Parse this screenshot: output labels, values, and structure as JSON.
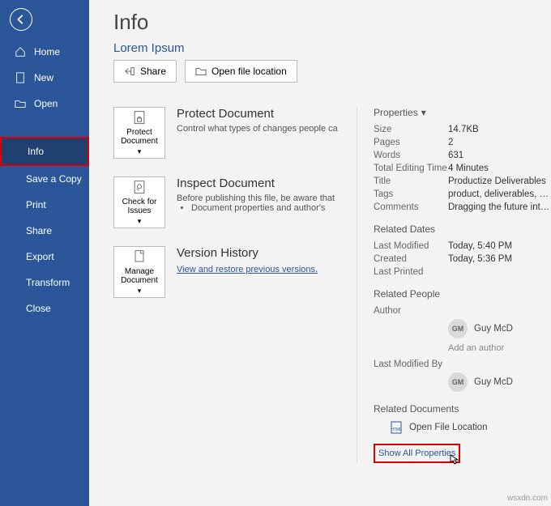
{
  "sidebar": {
    "items": [
      {
        "label": "Home"
      },
      {
        "label": "New"
      },
      {
        "label": "Open"
      },
      {
        "label": "Info",
        "selected": true
      },
      {
        "label": "Save a Copy"
      },
      {
        "label": "Print"
      },
      {
        "label": "Share"
      },
      {
        "label": "Export"
      },
      {
        "label": "Transform"
      },
      {
        "label": "Close"
      }
    ]
  },
  "page": {
    "title": "Info",
    "doc_name": "Lorem Ipsum",
    "share": "Share",
    "open_loc": "Open file location"
  },
  "protect": {
    "tile": "Protect Document",
    "head": "Protect Document",
    "desc": "Control what types of changes people ca"
  },
  "inspect": {
    "tile": "Check for Issues",
    "head": "Inspect Document",
    "desc": "Before publishing this file, be aware that",
    "bullet": "Document properties and author's"
  },
  "history": {
    "tile": "Manage Document",
    "head": "Version History",
    "link": "View and restore previous versions."
  },
  "props": {
    "head": "Properties",
    "size_k": "Size",
    "size_v": "14.7KB",
    "pages_k": "Pages",
    "pages_v": "2",
    "words_k": "Words",
    "words_v": "631",
    "tet_k": "Total Editing Time",
    "tet_v": "4 Minutes",
    "title_k": "Title",
    "title_v": "Productize Deliverables",
    "tags_k": "Tags",
    "tags_v": "product, deliverables, opti…",
    "comments_k": "Comments",
    "comments_v": "Dragging the future into n…"
  },
  "dates": {
    "head": "Related Dates",
    "lm_k": "Last Modified",
    "lm_v": "Today, 5:40 PM",
    "cr_k": "Created",
    "cr_v": "Today, 5:36 PM",
    "lp_k": "Last Printed",
    "lp_v": ""
  },
  "people": {
    "head": "Related People",
    "author_k": "Author",
    "initials": "GM",
    "name": "Guy McD",
    "add": "Add an author",
    "lmb_k": "Last Modified By"
  },
  "docs": {
    "head": "Related Documents",
    "ofl": "Open File Location",
    "show_all": "Show All Properties"
  },
  "watermark": "wsxdn.com"
}
